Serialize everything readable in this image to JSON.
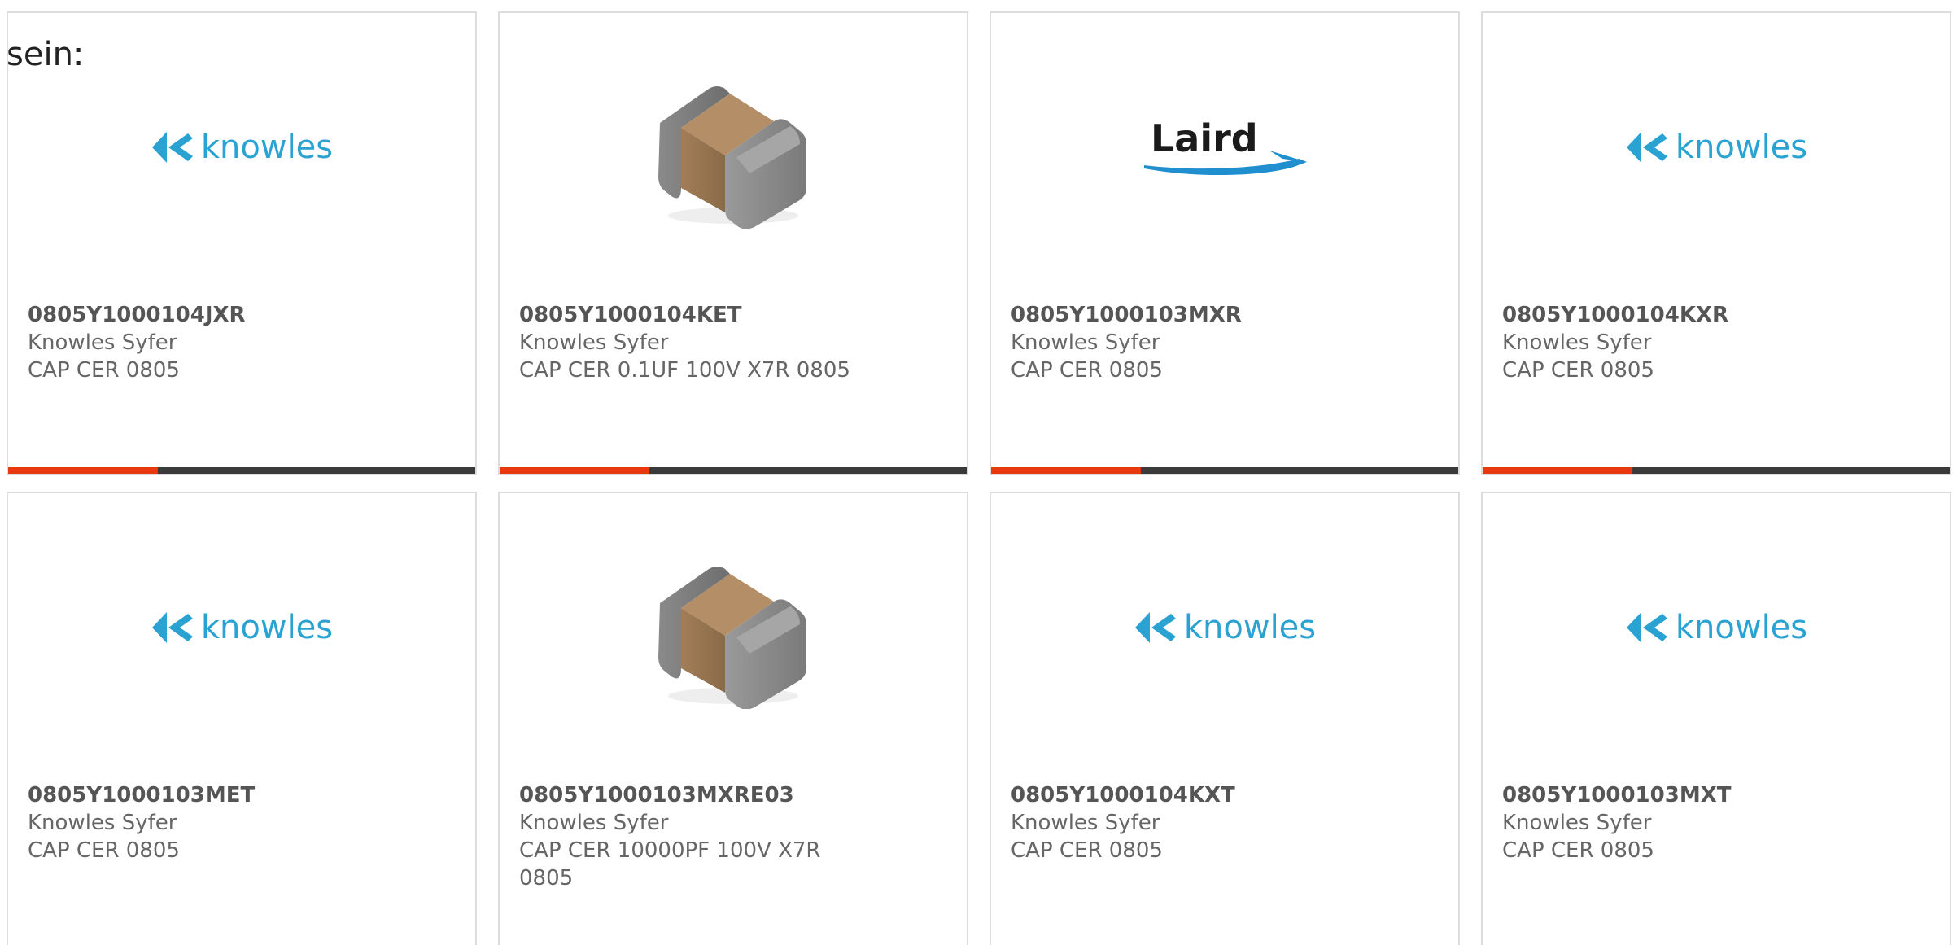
{
  "intro_text": "sein:",
  "colors": {
    "knowles_blue": "#2aa3d3",
    "laird_blue": "#1f8fd0",
    "accent_red": "#e8380d",
    "accent_dark": "#3a3a3a"
  },
  "products": [
    {
      "part": "0805Y1000104JXR",
      "manufacturer": "Knowles Syfer",
      "description": "CAP CER 0805",
      "image": "knowles-logo",
      "logo_text": "knowles",
      "accent_fraction": 0.32
    },
    {
      "part": "0805Y1000104KET",
      "manufacturer": "Knowles Syfer",
      "description": "CAP CER 0.1UF 100V X7R 0805",
      "image": "capacitor-chip",
      "accent_fraction": 0.32
    },
    {
      "part": "0805Y1000103MXR",
      "manufacturer": "Knowles Syfer",
      "description": "CAP CER 0805",
      "image": "laird-logo",
      "logo_text": "Laird",
      "accent_fraction": 0.32
    },
    {
      "part": "0805Y1000104KXR",
      "manufacturer": "Knowles Syfer",
      "description": "CAP CER 0805",
      "image": "knowles-logo",
      "logo_text": "knowles",
      "accent_fraction": 0.32
    },
    {
      "part": "0805Y1000103MET",
      "manufacturer": "Knowles Syfer",
      "description": "CAP CER 0805",
      "image": "knowles-logo",
      "logo_text": "knowles"
    },
    {
      "part": "0805Y1000103MXRE03",
      "manufacturer": "Knowles Syfer",
      "description": "CAP CER 10000PF 100V X7R 0805",
      "image": "capacitor-chip"
    },
    {
      "part": "0805Y1000104KXT",
      "manufacturer": "Knowles Syfer",
      "description": "CAP CER 0805",
      "image": "knowles-logo",
      "logo_text": "knowles"
    },
    {
      "part": "0805Y1000103MXT",
      "manufacturer": "Knowles Syfer",
      "description": "CAP CER 0805",
      "image": "knowles-logo",
      "logo_text": "knowles"
    }
  ]
}
